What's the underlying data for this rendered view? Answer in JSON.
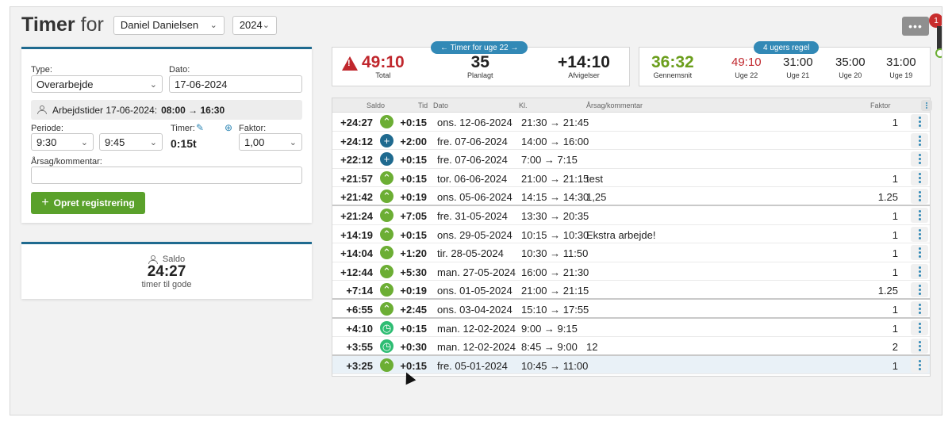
{
  "header": {
    "title_strong": "Timer",
    "title_light": "for",
    "employee": "Daniel Danielsen",
    "year": "2024",
    "more": "•••",
    "notification_count": "1"
  },
  "form": {
    "type_label": "Type:",
    "type_value": "Overarbejde",
    "date_label": "Dato:",
    "date_value": "17-06-2024",
    "info_prefix": "Arbejdstider 17-06-2024:",
    "info_hours": "08:00 → 16:30",
    "period_label": "Periode:",
    "period_from": "9:30",
    "period_to": "9:45",
    "hours_label": "Timer:",
    "hours_value": "0:15t",
    "factor_label": "Faktor:",
    "factor_value": "1,00",
    "comment_label": "Årsag/kommentar:",
    "comment_value": "",
    "create_button": "Opret registrering"
  },
  "saldo": {
    "label": "Saldo",
    "value": "24:27",
    "sub": "timer til gode"
  },
  "week_stats": {
    "pill": "← Timer for uge 22 →",
    "total_value": "49:10",
    "total_label": "Total",
    "planned_value": "35",
    "planned_label": "Planlagt",
    "deviation_value": "+14:10",
    "deviation_label": "Afvigelser"
  },
  "rule_stats": {
    "pill": "4 ugers regel",
    "avg_value": "36:32",
    "avg_label": "Gennemsnit",
    "weeks": [
      {
        "value": "49:10",
        "label": "Uge 22"
      },
      {
        "value": "31:00",
        "label": "Uge 21"
      },
      {
        "value": "35:00",
        "label": "Uge 20"
      },
      {
        "value": "31:00",
        "label": "Uge 19"
      }
    ]
  },
  "table": {
    "headers": {
      "saldo": "Saldo",
      "tid": "Tid",
      "dato": "Dato",
      "kl": "Kl.",
      "aarsag": "Årsag/kommentar",
      "faktor": "Faktor"
    },
    "rows": [
      {
        "saldo": "+24:27",
        "icon": "chevron-up",
        "tid": "+0:15",
        "dato": "ons. 12-06-2024",
        "kl": "21:30 → 21:45",
        "aarsag": "",
        "faktor": "1"
      },
      {
        "saldo": "+24:12",
        "icon": "plus",
        "tid": "+2:00",
        "dato": "fre. 07-06-2024",
        "kl": "14:00 → 16:00",
        "aarsag": "",
        "faktor": ""
      },
      {
        "saldo": "+22:12",
        "icon": "plus",
        "tid": "+0:15",
        "dato": "fre. 07-06-2024",
        "kl": "7:00 → 7:15",
        "aarsag": "",
        "faktor": ""
      },
      {
        "saldo": "+21:57",
        "icon": "chevron-up",
        "tid": "+0:15",
        "dato": "tor. 06-06-2024",
        "kl": "21:00 → 21:15",
        "aarsag": "test",
        "faktor": "1"
      },
      {
        "saldo": "+21:42",
        "icon": "chevron-up",
        "tid": "+0:19",
        "dato": "ons. 05-06-2024",
        "kl": "14:15 → 14:30",
        "aarsag": "1,25",
        "faktor": "1.25"
      },
      {
        "saldo": "+21:24",
        "icon": "chevron-up",
        "tid": "+7:05",
        "dato": "fre. 31-05-2024",
        "kl": "13:30 → 20:35",
        "aarsag": "",
        "faktor": "1"
      },
      {
        "saldo": "+14:19",
        "icon": "chevron-up",
        "tid": "+0:15",
        "dato": "ons. 29-05-2024",
        "kl": "10:15 → 10:30",
        "aarsag": "Ekstra arbejde!",
        "faktor": "1"
      },
      {
        "saldo": "+14:04",
        "icon": "chevron-up",
        "tid": "+1:20",
        "dato": "tir. 28-05-2024",
        "kl": "10:30 → 11:50",
        "aarsag": "",
        "faktor": "1"
      },
      {
        "saldo": "+12:44",
        "icon": "chevron-up",
        "tid": "+5:30",
        "dato": "man. 27-05-2024",
        "kl": "16:00 → 21:30",
        "aarsag": "",
        "faktor": "1"
      },
      {
        "saldo": "+7:14",
        "icon": "chevron-up",
        "tid": "+0:19",
        "dato": "ons. 01-05-2024",
        "kl": "21:00 → 21:15",
        "aarsag": "",
        "faktor": "1.25"
      },
      {
        "saldo": "+6:55",
        "icon": "chevron-up",
        "tid": "+2:45",
        "dato": "ons. 03-04-2024",
        "kl": "15:10 → 17:55",
        "aarsag": "",
        "faktor": "1"
      },
      {
        "saldo": "+4:10",
        "icon": "clock",
        "tid": "+0:15",
        "dato": "man. 12-02-2024",
        "kl": "9:00 → 9:15",
        "aarsag": "",
        "faktor": "1"
      },
      {
        "saldo": "+3:55",
        "icon": "clock",
        "tid": "+0:30",
        "dato": "man. 12-02-2024",
        "kl": "8:45 → 9:00",
        "aarsag": "12",
        "faktor": "2"
      },
      {
        "saldo": "+3:25",
        "icon": "chevron-up",
        "tid": "+0:15",
        "dato": "fre. 05-01-2024",
        "kl": "10:45 → 11:00",
        "aarsag": "",
        "faktor": "1"
      }
    ]
  },
  "colors": {
    "accent": "#1f6a8f",
    "pill": "#3289b6",
    "green": "#6cae34",
    "warning_red": "#c0272d",
    "avg_green": "#6b9e1c"
  }
}
